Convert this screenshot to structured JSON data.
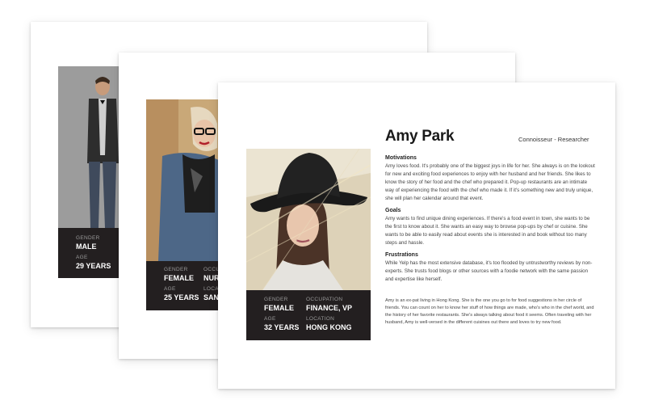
{
  "cards": [
    {
      "gender_label": "GENDER",
      "gender": "MALE",
      "age_label": "AGE",
      "age": "29 YEARS"
    },
    {
      "gender_label": "GENDER",
      "gender": "FEMALE",
      "occupation_label": "OCCU",
      "occupation": "NUR",
      "age_label": "AGE",
      "age": "25 YEARS",
      "location_label": "LOCA",
      "location": "SAN"
    },
    {
      "name": "Amy Park",
      "role": "Connoisseur - Researcher",
      "gender_label": "GENDER",
      "gender": "FEMALE",
      "occupation_label": "OCCUPATION",
      "occupation": "FINANCE, VP",
      "age_label": "AGE",
      "age": "32 YEARS",
      "location_label": "LOCATION",
      "location": "HONG KONG",
      "sections": [
        {
          "title": "Motivations",
          "text": "Amy loves food. It's probably one of the biggest joys in life for her. She always is on the lookout for new and exciting food experiences to enjoy with her husband and her friends. She likes to know the story of her food and the chef who prepared it. Pop-up restaurants are an intimate way of experiencing the food with the chef who made it. If it's something new and truly unique, she will plan her calendar around that event."
        },
        {
          "title": "Goals",
          "text": "Amy wants to find unique dining experiences. If there's a food event in town, she wants to be the first to know about it. She wants an easy way to browse pop-ups by chef or cuisine. She wants to be able to easily read about events she is interested in and book without too many steps and hassle."
        },
        {
          "title": "Frustrations",
          "text": "While Yelp has the most extensive database, it's too flooded by untrustworthy reviews by non-experts. She trusts food blogs or other sources with a foodie network with the same passion and expertise like herself."
        }
      ],
      "bio": "Amy is an ex-pat living in Hong Kong. She is the one you go to for food suggestions in her circle of friends. You can count on her to know her stuff of how things are made, who's who in the chef world, and the history of her favorite restaurants. She's always talking about food it seems. Often traveling with her husband, Amy is well-versed in the different cuisines out there and loves to try new food."
    }
  ]
}
